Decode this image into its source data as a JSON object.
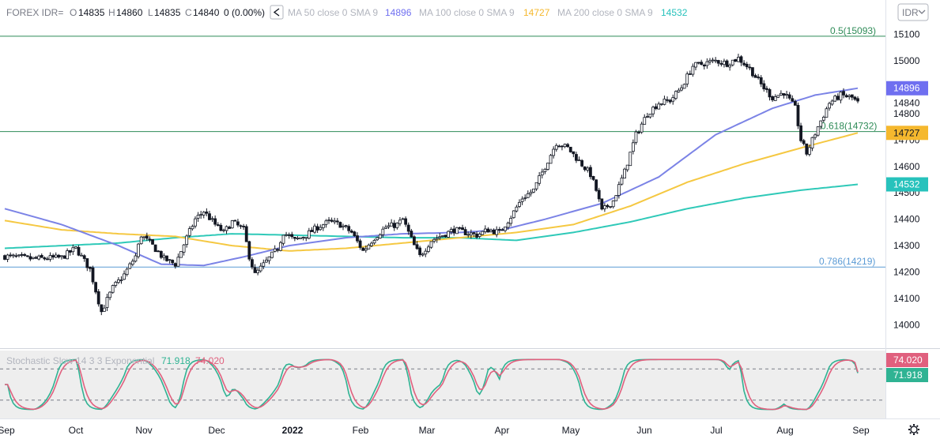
{
  "header": {
    "symbol": "FOREX IDR=",
    "o_label": "O",
    "o_value": "14835",
    "h_label": "H",
    "h_value": "14860",
    "l_label": "L",
    "l_value": "14835",
    "c_label": "C",
    "c_value": "14840",
    "change": "0 (0.00%)",
    "collapse_icon": "chevron-left-icon",
    "ma50_label": "MA 50 close 0 SMA 9",
    "ma50_value": "14896",
    "ma100_label": "MA 100 close 0 SMA 9",
    "ma100_value": "14727",
    "ma200_label": "MA 200 close 0 SMA 9",
    "ma200_value": "14532",
    "currency_button": "IDR",
    "currency_icon": "chevron-down-icon"
  },
  "stochastic": {
    "label": "Stochastic Slow 14 3 3 Exponential",
    "k_value": "71.918",
    "d_value": "74.020"
  },
  "settings_icon": "gear-icon",
  "colors": {
    "ma50": "#7b83e6",
    "ma100": "#f5c842",
    "ma200": "#2fc9b8",
    "fib": "#2e8b57",
    "fib786": "#5b9bd5",
    "stoch_k": "#2fb393",
    "stoch_d": "#e0607e",
    "last_price_label": "#131722"
  },
  "chart_data": {
    "type": "candlestick",
    "price_axis": {
      "ticks": [
        "15100",
        "15000",
        "14900",
        "14800",
        "14700",
        "14600",
        "14500",
        "14400",
        "14300",
        "14200",
        "14100",
        "14000"
      ],
      "range": [
        13920,
        15150
      ]
    },
    "time_axis": {
      "ticks": [
        "Sep",
        "Oct",
        "Nov",
        "Dec",
        "2022",
        "Feb",
        "Mar",
        "Apr",
        "May",
        "Jun",
        "Jul",
        "Aug",
        "Sep"
      ]
    },
    "fib_levels": [
      {
        "label": "0.5(15093)",
        "value": 15093
      },
      {
        "label": "0.618(14732)",
        "value": 14732
      },
      {
        "label": "0.786(14219)",
        "value": 14219
      }
    ],
    "axis_labels": [
      {
        "text": "14896",
        "color": "#6f6ff0"
      },
      {
        "text": "14840",
        "color": "#ffffff"
      },
      {
        "text": "14727",
        "color": "#f5b82e"
      },
      {
        "text": "14532",
        "color": "#27c2bc"
      }
    ],
    "closes_anchors": [
      [
        0,
        14260
      ],
      [
        10,
        14250
      ],
      [
        20,
        14255
      ],
      [
        25,
        14290
      ],
      [
        30,
        14210
      ],
      [
        32,
        14130
      ],
      [
        34,
        14050
      ],
      [
        38,
        14140
      ],
      [
        42,
        14190
      ],
      [
        46,
        14260
      ],
      [
        48,
        14340
      ],
      [
        52,
        14300
      ],
      [
        56,
        14250
      ],
      [
        60,
        14230
      ],
      [
        64,
        14330
      ],
      [
        67,
        14400
      ],
      [
        70,
        14430
      ],
      [
        74,
        14380
      ],
      [
        77,
        14350
      ],
      [
        80,
        14390
      ],
      [
        84,
        14360
      ],
      [
        86,
        14260
      ],
      [
        88,
        14190
      ],
      [
        92,
        14240
      ],
      [
        96,
        14290
      ],
      [
        98,
        14350
      ],
      [
        102,
        14320
      ],
      [
        106,
        14340
      ],
      [
        110,
        14370
      ],
      [
        114,
        14390
      ],
      [
        118,
        14380
      ],
      [
        122,
        14350
      ],
      [
        126,
        14280
      ],
      [
        130,
        14330
      ],
      [
        134,
        14370
      ],
      [
        138,
        14380
      ],
      [
        140,
        14400
      ],
      [
        144,
        14300
      ],
      [
        146,
        14260
      ],
      [
        150,
        14320
      ],
      [
        154,
        14340
      ],
      [
        158,
        14360
      ],
      [
        162,
        14350
      ],
      [
        166,
        14340
      ],
      [
        170,
        14360
      ],
      [
        174,
        14350
      ],
      [
        178,
        14410
      ],
      [
        182,
        14480
      ],
      [
        186,
        14510
      ],
      [
        190,
        14600
      ],
      [
        194,
        14690
      ],
      [
        198,
        14670
      ],
      [
        202,
        14620
      ],
      [
        206,
        14570
      ],
      [
        208,
        14510
      ],
      [
        210,
        14430
      ],
      [
        214,
        14470
      ],
      [
        218,
        14580
      ],
      [
        222,
        14720
      ],
      [
        226,
        14800
      ],
      [
        230,
        14840
      ],
      [
        234,
        14850
      ],
      [
        238,
        14900
      ],
      [
        242,
        14980
      ],
      [
        246,
        14990
      ],
      [
        250,
        15000
      ],
      [
        254,
        14990
      ],
      [
        258,
        15010
      ],
      [
        262,
        14970
      ],
      [
        266,
        14910
      ],
      [
        270,
        14860
      ],
      [
        274,
        14880
      ],
      [
        278,
        14820
      ],
      [
        280,
        14700
      ],
      [
        282,
        14650
      ],
      [
        286,
        14750
      ],
      [
        290,
        14840
      ],
      [
        294,
        14870
      ],
      [
        298,
        14860
      ],
      [
        300,
        14840
      ]
    ],
    "ma50_points": [
      [
        0,
        14440
      ],
      [
        20,
        14380
      ],
      [
        40,
        14300
      ],
      [
        55,
        14230
      ],
      [
        70,
        14225
      ],
      [
        85,
        14260
      ],
      [
        100,
        14300
      ],
      [
        120,
        14330
      ],
      [
        140,
        14345
      ],
      [
        160,
        14350
      ],
      [
        175,
        14360
      ],
      [
        190,
        14400
      ],
      [
        210,
        14460
      ],
      [
        230,
        14560
      ],
      [
        250,
        14720
      ],
      [
        270,
        14820
      ],
      [
        285,
        14870
      ],
      [
        300,
        14896
      ]
    ],
    "ma100_points": [
      [
        0,
        14395
      ],
      [
        20,
        14360
      ],
      [
        40,
        14345
      ],
      [
        60,
        14335
      ],
      [
        80,
        14300
      ],
      [
        100,
        14280
      ],
      [
        120,
        14290
      ],
      [
        140,
        14310
      ],
      [
        160,
        14330
      ],
      [
        180,
        14350
      ],
      [
        200,
        14380
      ],
      [
        220,
        14450
      ],
      [
        240,
        14540
      ],
      [
        260,
        14610
      ],
      [
        280,
        14670
      ],
      [
        300,
        14727
      ]
    ],
    "ma200_points": [
      [
        0,
        14290
      ],
      [
        20,
        14300
      ],
      [
        40,
        14310
      ],
      [
        60,
        14330
      ],
      [
        80,
        14345
      ],
      [
        100,
        14340
      ],
      [
        120,
        14335
      ],
      [
        140,
        14330
      ],
      [
        160,
        14330
      ],
      [
        180,
        14320
      ],
      [
        200,
        14350
      ],
      [
        220,
        14390
      ],
      [
        240,
        14440
      ],
      [
        260,
        14480
      ],
      [
        280,
        14510
      ],
      [
        300,
        14532
      ]
    ],
    "stochastic": {
      "range": [
        0,
        100
      ],
      "bands": [
        80,
        20
      ],
      "k_last": 71.918,
      "d_last": 74.02
    }
  }
}
